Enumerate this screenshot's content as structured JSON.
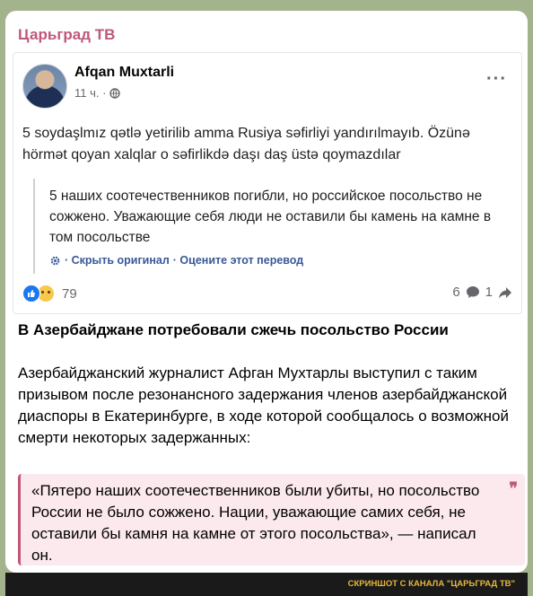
{
  "channel": {
    "name": "Царьград ТВ",
    "accent_color": "#c0577b"
  },
  "post": {
    "author": "Afqan Muxtarli",
    "time": "11 ч. ·",
    "text": "5 soydaşlmız qətlə yetirilib amma Rusiya səfirliyi yandırılmayıb. Özünə hörmət qoyan xalqlar o səfirlikdə daşı daş üstə qoymazdılar",
    "translation": "5 наших соотечественников погибли, но российское посольство не сожжено. Уважающие себя люди не оставили бы камень на камне в том посольстве",
    "hide_original": "· Скрыть оригинал",
    "rate_translation": "· Оцените этот перевод",
    "reaction_count": "79",
    "comment_count": "6",
    "share_count": "1",
    "icons": [
      "avatar",
      "globe-icon",
      "more-icon",
      "gear-icon",
      "like-icon",
      "sad-icon",
      "comment-icon",
      "share-icon"
    ]
  },
  "article": {
    "headline": "В Азербайджане потребовали сжечь посольство России",
    "body": "Азербайджанский журналист Афган Мухтарлы выступил с таким призывом после резонансного задержания членов азербайджанской диаспоры в Екатеринбурге, в ходе которой сообщалось о возможной смерти некоторых задержанных:",
    "quote": "«Пятеро наших соотечественников были убиты, но посольство России не было сожжено. Нации, уважающие самих себя, не оставили бы камня на камне от этого посольства», — написал он.",
    "quote_mark": "❞"
  },
  "footer": {
    "caption": "СКРИНШОТ С КАНАЛА \"ЦАРЬГРАД ТВ\""
  }
}
